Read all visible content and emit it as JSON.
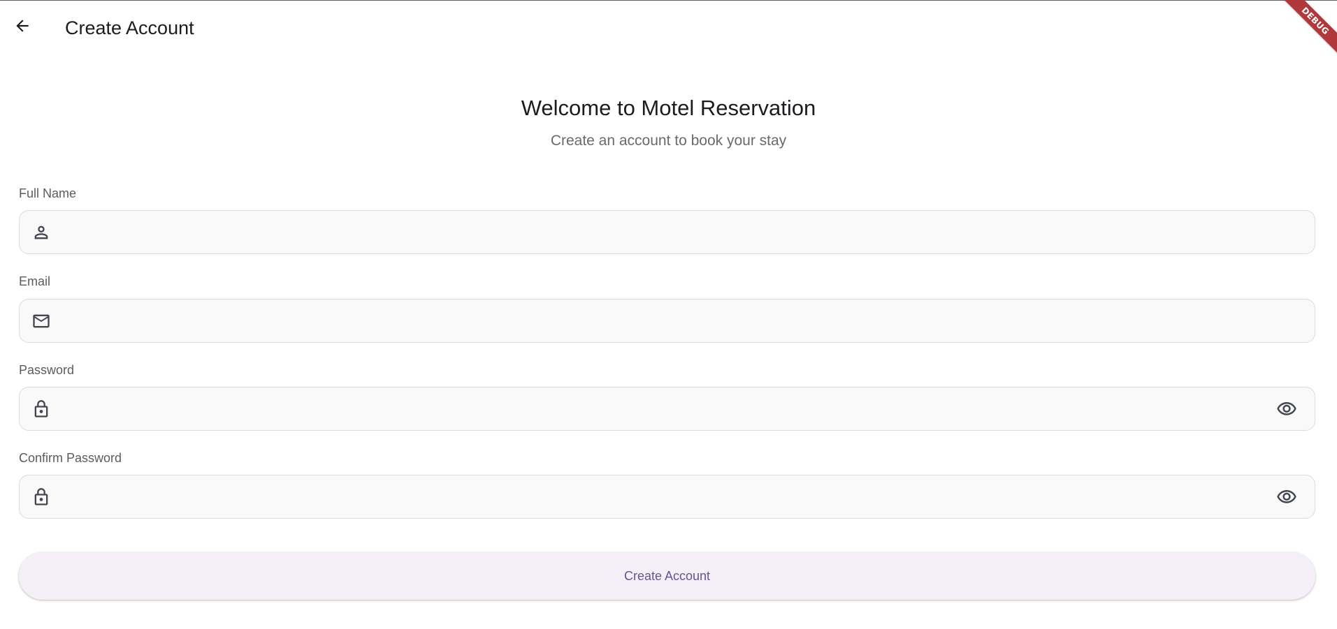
{
  "app_bar": {
    "title": "Create Account",
    "back_icon": "arrow-left-icon"
  },
  "debug_banner": "DEBUG",
  "header": {
    "welcome": "Welcome to Motel Reservation",
    "subtitle": "Create an account to book your stay"
  },
  "form": {
    "full_name": {
      "label": "Full Name",
      "value": "",
      "icon": "person-icon"
    },
    "email": {
      "label": "Email",
      "value": "",
      "icon": "mail-icon"
    },
    "password": {
      "label": "Password",
      "value": "",
      "icon": "lock-icon",
      "toggle_icon": "eye-icon"
    },
    "confirm_password": {
      "label": "Confirm Password",
      "value": "",
      "icon": "lock-icon",
      "toggle_icon": "eye-icon"
    },
    "submit_label": "Create Account"
  },
  "colors": {
    "button_bg": "#f5f0f8",
    "button_text": "#65558f",
    "field_bg": "#f9f9f9",
    "field_border": "#dcdcdc",
    "debug_banner": "#b0383a"
  }
}
